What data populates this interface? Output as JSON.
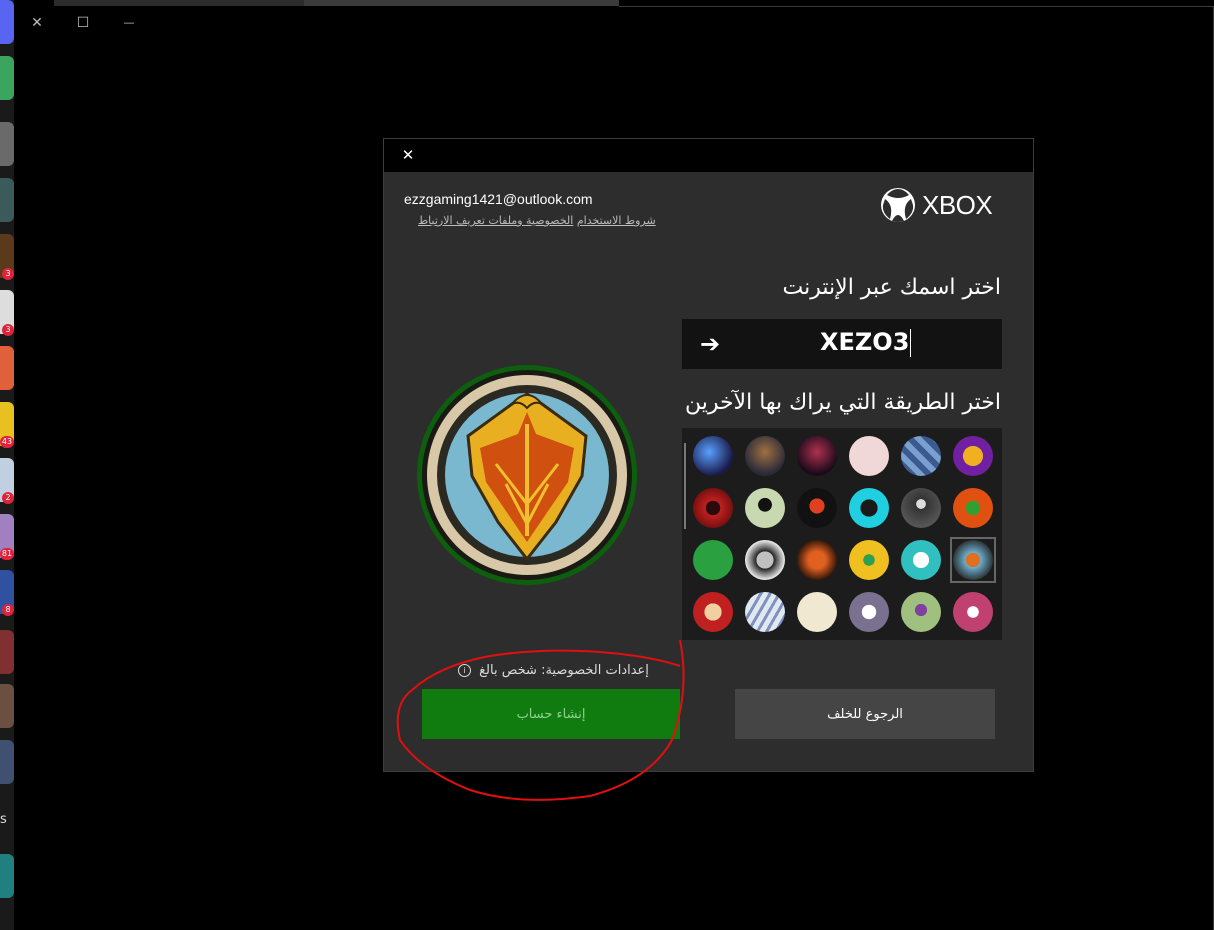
{
  "window": {
    "close_glyph": "✕",
    "maximize_glyph": "☐",
    "minimize_glyph": "—"
  },
  "taskbar": {
    "badges": [
      "3",
      "3",
      "43",
      "2",
      "81",
      "8"
    ],
    "letter": "s"
  },
  "dialog": {
    "close_glyph": "✕",
    "email": "ezzgaming1421@outlook.com",
    "links": {
      "terms": "شروط الاستخدام",
      "privacy": "الخصوصية وملفات تعريف الارتباط"
    },
    "brand": "XBOX",
    "gamertag_heading": "اختر اسمك عبر الإنترنت",
    "gamertag_value": "XEZO3",
    "gamertag_arrow": "➔",
    "picture_heading": "اختر الطريقة التي يراك بها الآخرين",
    "privacy_note": "إعدادات الخصوصية: شخص بالغ",
    "info_glyph": "i",
    "create_button": "إنشاء حساب",
    "back_button": "الرجوع للخلف"
  },
  "colors": {
    "accent_green": "#107c10",
    "annotation_red": "#e01010"
  }
}
